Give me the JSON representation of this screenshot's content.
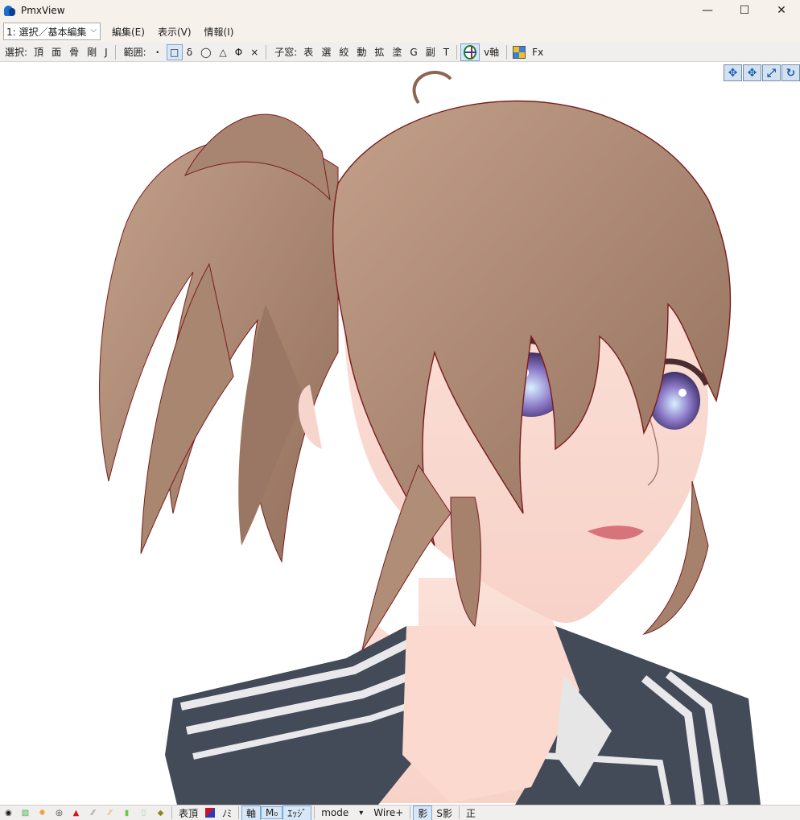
{
  "window": {
    "title": "PmxView"
  },
  "menubar": {
    "mode_value": "1: 選択／基本編集",
    "items": [
      "編集(E)",
      "表示(V)",
      "情報(I)"
    ]
  },
  "toolbar": {
    "select_label": "選択:",
    "select_items": [
      "頂",
      "面",
      "骨",
      "剛",
      "J"
    ],
    "range_label": "範囲:",
    "range_items": [
      "・",
      "□",
      "δ",
      "◯",
      "△",
      "Φ",
      "×"
    ],
    "child_label": "子窓:",
    "child_items": [
      "表",
      "選",
      "絞",
      "動",
      "拡",
      "塗",
      "G",
      "副",
      "T"
    ],
    "v_axis_label": "v軸",
    "fx_label": "Fx"
  },
  "view_tools": [
    "move-xy",
    "move-xz",
    "zoom",
    "rotate"
  ],
  "statusbar": {
    "table_label": "表頂",
    "mi_label": "ﾉﾐ",
    "axis_label": "軸",
    "mo_label": "M₀",
    "edge_label": "ｴｯｼﾞ",
    "mode_label": "mode",
    "wire_label": "Wire+",
    "shadow_label": "影",
    "sshadow_label": "S影",
    "correct_label": "正"
  },
  "colors": {
    "hair": "#b3917b",
    "hair_dark": "#8b6653",
    "skin": "#fbe2da",
    "uniform": "#434a58",
    "stripe": "#e9e9ec",
    "iris": "#8b78c8"
  }
}
